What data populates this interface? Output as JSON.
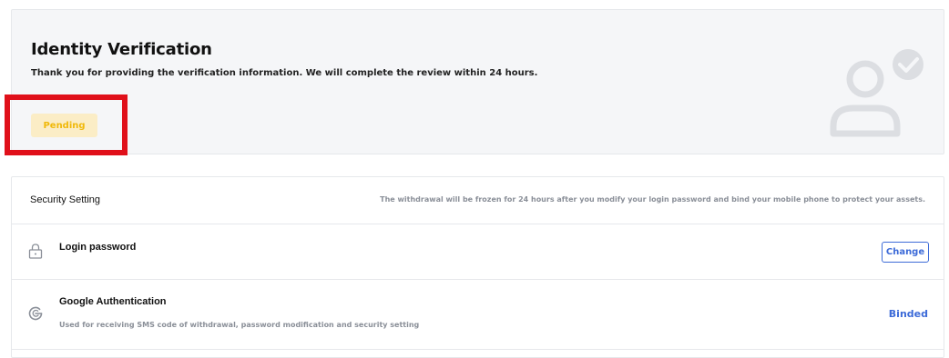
{
  "identity": {
    "title": "Identity Verification",
    "description": "Thank you for providing the verification information. We will complete the review within 24 hours.",
    "status": "Pending",
    "status_color": "#f0b90b",
    "status_bg": "#fbedc6",
    "icon": "user-verified-icon"
  },
  "security": {
    "title": "Security Setting",
    "note": "The withdrawal will be frozen for 24 hours after you modify your login password and bind your mobile phone to protect your assets.",
    "rows": [
      {
        "icon": "lock-icon",
        "title": "Login password",
        "subtitle": "",
        "action": "Change"
      },
      {
        "icon": "google-icon",
        "title": "Google Authentication",
        "subtitle": "Used for receiving SMS code of withdrawal, password modification and security setting",
        "action": "Binded"
      }
    ]
  },
  "colors": {
    "accent": "#3d6bd8",
    "highlight": "#e0101a",
    "muted_text": "#8a8f98"
  }
}
